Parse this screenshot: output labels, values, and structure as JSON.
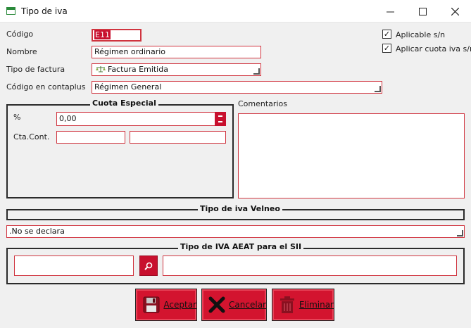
{
  "window": {
    "title": "Tipo de iva",
    "minimize": "—",
    "maximize": "☐",
    "close": "✕"
  },
  "form": {
    "codigo_label": "Código",
    "codigo_value": "E11",
    "nombre_label": "Nombre",
    "nombre_value": "Régimen ordinario",
    "tipo_factura_label": "Tipo de factura",
    "tipo_factura_value": "Factura Emitida",
    "codigo_contaplus_label": "Código en contaplus",
    "codigo_contaplus_value": "Régimen General",
    "aplicable_label": "Aplicable s/n",
    "aplicable_checked": true,
    "aplicar_cuota_label": "Aplicar cuota iva s/n",
    "aplicar_cuota_checked": true,
    "check_mark": "✓"
  },
  "cuota_especial": {
    "title": "Cuota Especial",
    "porcentaje_label": "%",
    "porcentaje_value": "0,00",
    "cta_cont_label": "Cta.Cont.",
    "cta_cont_value_1": "",
    "cta_cont_value_2": ""
  },
  "comentarios": {
    "label": "Comentarios",
    "value": ""
  },
  "tipo_iva_velneo": {
    "title": "Tipo de iva Velneo",
    "value": ".No se declara"
  },
  "tipo_iva_aeat": {
    "title": "Tipo de IVA AEAT para el SII",
    "code_value": "",
    "description_value": ""
  },
  "buttons": {
    "aceptar": "Aceptar",
    "cancelar": "Cancelar",
    "eliminar": "Eliminar"
  },
  "colors": {
    "accent": "#d3142f",
    "border": "#d0343f",
    "group_border": "#2b2b2b"
  }
}
